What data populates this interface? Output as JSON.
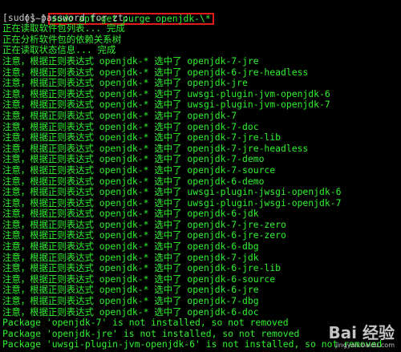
{
  "prompt": "[$~]",
  "command": "sudo apt-get purge openjdk-\\*",
  "sudo_line": "[sudo] password for zt:",
  "status_lines": [
    "正在读取软件包列表... 完成",
    "正在分析软件包的依赖关系树",
    "正在读取状态信息... 完成"
  ],
  "notice_prefix": "注意，根据正则表达式",
  "notice_pattern": "openjdk-*",
  "notice_verb": "选中了",
  "selected_packages": [
    "openjdk-7-jre",
    "openjdk-6-jre-headless",
    "openjdk-jre",
    "uwsgi-plugin-jvm-openjdk-6",
    "uwsgi-plugin-jvm-openjdk-7",
    "openjdk-7",
    "openjdk-7-doc",
    "openjdk-7-jre-lib",
    "openjdk-7-jre-headless",
    "openjdk-7-demo",
    "openjdk-7-source",
    "openjdk-6-demo",
    "uwsgi-plugin-jwsgi-openjdk-6",
    "uwsgi-plugin-jwsgi-openjdk-7",
    "openjdk-6-jdk",
    "openjdk-7-jre-zero",
    "openjdk-6-jre-zero",
    "openjdk-6-dbg",
    "openjdk-7-jdk",
    "openjdk-6-jre-lib",
    "openjdk-6-source",
    "openjdk-6-jre",
    "openjdk-7-dbg",
    "openjdk-6-doc"
  ],
  "package_lines": [
    "Package 'openjdk-7' is not installed, so not removed",
    "Package 'openjdk-jre' is not installed, so not removed",
    "Package 'uwsgi-plugin-jvm-openjdk-6' is not installed, so not removed"
  ],
  "watermark": {
    "brand": "Bai 经验",
    "url": "jingyan.baidu.com"
  },
  "colors": {
    "background": "#000000",
    "text_green": "#2ff22f",
    "text_gray": "#c8c8c8",
    "highlight_red": "#e21a1a"
  }
}
